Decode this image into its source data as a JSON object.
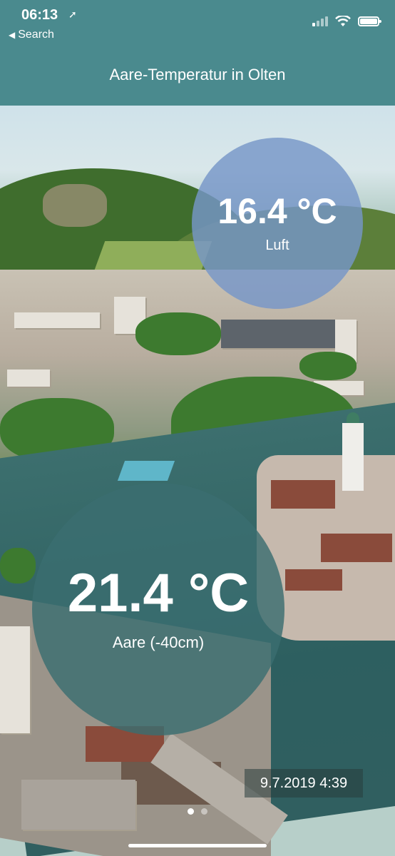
{
  "status_bar": {
    "time": "06:13",
    "location_icon": "location-arrow-icon",
    "back_label": "Search"
  },
  "header": {
    "title": "Aare-Temperatur in Olten"
  },
  "air": {
    "temperature": "16.4 °C",
    "label": "Luft"
  },
  "water": {
    "temperature": "21.4 °C",
    "label": "Aare (-40cm)"
  },
  "timestamp": "9.7.2019 4:39",
  "pager": {
    "pages": 2,
    "active": 1
  },
  "colors": {
    "header_bg": "#4a8a8e",
    "air_circle": "#7696c8",
    "water_circle": "#3a6e70"
  }
}
